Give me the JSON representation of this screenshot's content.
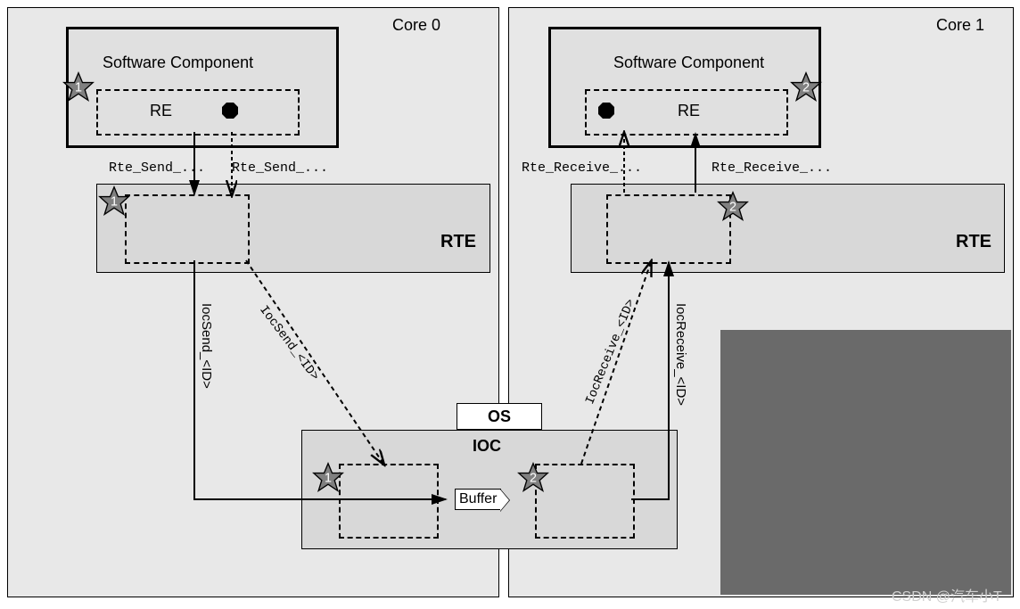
{
  "cores": {
    "left": {
      "label": "Core 0"
    },
    "right": {
      "label": "Core 1"
    }
  },
  "swc": {
    "left": {
      "label": "Software Component",
      "re": "RE"
    },
    "right": {
      "label": "Software Component",
      "re": "RE"
    }
  },
  "rte": {
    "label": "RTE"
  },
  "calls": {
    "rte_send_1": "Rte_Send_...",
    "rte_send_2": "Rte_Send_...",
    "rte_receive_1": "Rte_Receive_...",
    "rte_receive_2": "Rte_Receive_...",
    "ioc_send_solid": "IocSend_<ID>",
    "ioc_send_dashed": "IocSend_<ID>",
    "ioc_receive_solid": "IocReceive_<ID>",
    "ioc_receive_dashed": "IocReceive_<ID>"
  },
  "os": {
    "label": "OS"
  },
  "ioc": {
    "label": "IOC",
    "buffer": "Buffer"
  },
  "stars": {
    "one": "1",
    "two": "2"
  },
  "watermark": "CSDN @汽车小T"
}
